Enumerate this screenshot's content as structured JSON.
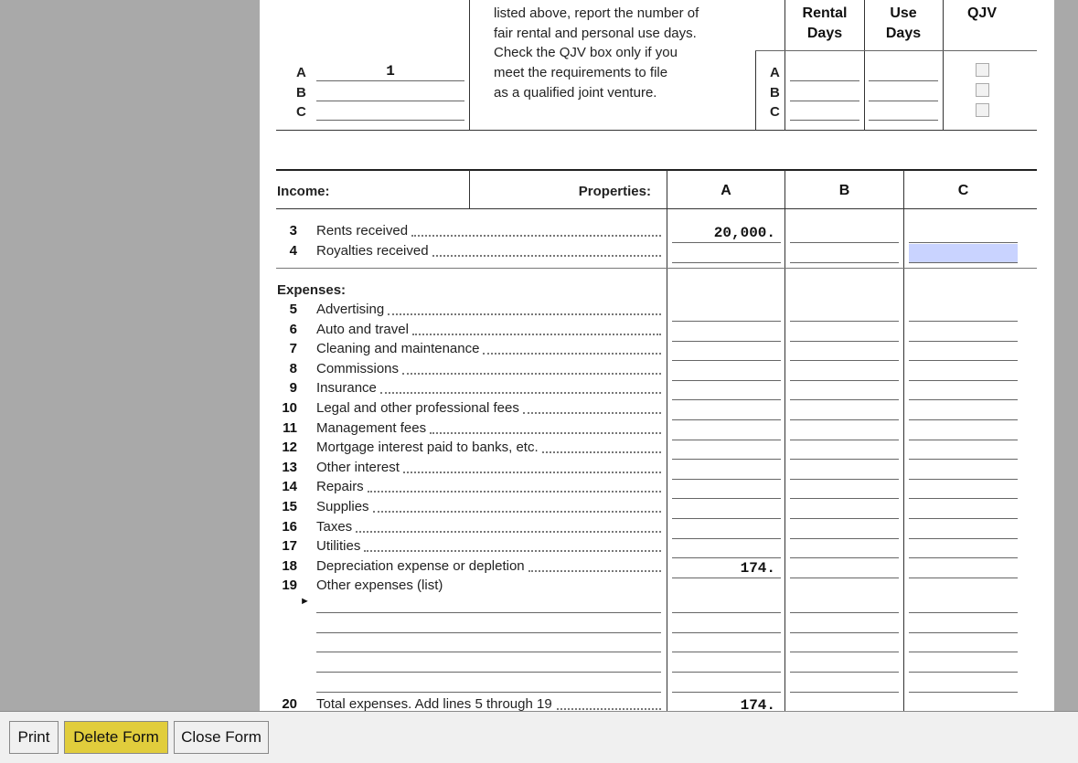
{
  "instructions": {
    "lines": [
      "listed above, report the number of",
      "fair rental and personal use days.",
      "Check the QJV box only if you",
      "meet the requirements to file",
      "as a qualified joint venture."
    ]
  },
  "property_type": {
    "rows": [
      {
        "letter": "A",
        "value": "1"
      },
      {
        "letter": "B",
        "value": ""
      },
      {
        "letter": "C",
        "value": ""
      }
    ]
  },
  "days_table": {
    "rental_header": [
      "Rental",
      "Days"
    ],
    "personal_header": [
      "Use",
      "Days"
    ],
    "qjv_header": "QJV",
    "letters": [
      "A",
      "B",
      "C"
    ]
  },
  "income": {
    "label": "Income:",
    "properties_label": "Properties:",
    "columns": [
      "A",
      "B",
      "C"
    ],
    "rows": [
      {
        "num": "3",
        "label": "Rents received",
        "A": "20,000.",
        "B": "",
        "C": ""
      },
      {
        "num": "4",
        "label": "Royalties received",
        "A": "",
        "B": "",
        "C": ""
      }
    ]
  },
  "expenses": {
    "label": "Expenses:",
    "rows": [
      {
        "num": "5",
        "label": "Advertising",
        "A": ""
      },
      {
        "num": "6",
        "label": "Auto and travel",
        "A": ""
      },
      {
        "num": "7",
        "label": "Cleaning and maintenance",
        "A": ""
      },
      {
        "num": "8",
        "label": "Commissions",
        "A": ""
      },
      {
        "num": "9",
        "label": "Insurance",
        "A": ""
      },
      {
        "num": "10",
        "label": "Legal and other professional fees",
        "A": ""
      },
      {
        "num": "11",
        "label": "Management fees",
        "A": ""
      },
      {
        "num": "12",
        "label": "Mortgage interest paid to banks, etc.",
        "A": ""
      },
      {
        "num": "13",
        "label": "Other interest",
        "A": ""
      },
      {
        "num": "14",
        "label": "Repairs",
        "A": ""
      },
      {
        "num": "15",
        "label": "Supplies",
        "A": ""
      },
      {
        "num": "16",
        "label": "Taxes",
        "A": ""
      },
      {
        "num": "17",
        "label": "Utilities",
        "A": ""
      },
      {
        "num": "18",
        "label": "Depreciation expense or depletion",
        "A": "174."
      },
      {
        "num": "19",
        "label": "Other expenses (list)",
        "A": ""
      }
    ],
    "other_marker": "►",
    "total": {
      "num": "20",
      "label": "Total expenses. Add lines 5 through 19",
      "A": "174."
    }
  },
  "toolbar": {
    "print_label": "Print",
    "delete_label": "Delete Form",
    "close_label": "Close Form",
    "delete_color": "#e1cd3c"
  },
  "colors": {
    "active_field": "#c9d3ff",
    "background": "#a9a9a9"
  }
}
